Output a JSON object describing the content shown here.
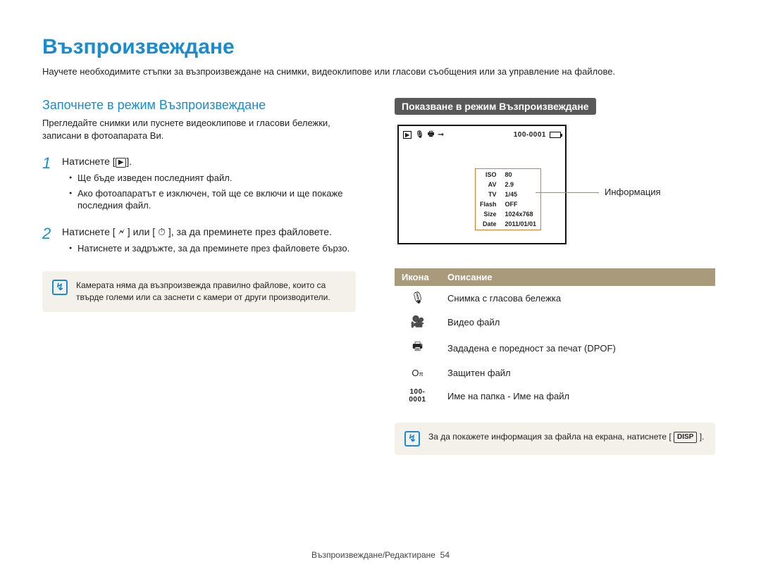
{
  "page_title": "Възпроизвеждане",
  "intro": "Научете необходимите стъпки за възпроизвеждане на снимки, видеоклипове или гласови съобщения или за управление на файлове.",
  "left": {
    "heading": "Започнете в режим Възпроизвеждане",
    "subintro": "Прегледайте снимки или пуснете видеоклипове и гласови бележки, записани в фотоапарата Ви.",
    "steps": [
      {
        "num": "1",
        "label_pre": "Натиснете [",
        "label_post": "].",
        "bullets": [
          "Ще бъде изведен последният файл.",
          "Ако фотоапаратът е изключен, той ще се включи и ще покаже последния файл."
        ]
      },
      {
        "num": "2",
        "label": "Натиснете [ 🗲 ] или [ ⏱ ], за да преминете през файловете.",
        "bullets": [
          "Натиснете и задръжте, за да преминете през файловете бързо."
        ]
      }
    ],
    "note": "Камерата няма да възпроизвежда правилно файлове, които са твърде големи или са заснети с камери от други производители."
  },
  "right": {
    "heading": "Показване в режим Възпроизвеждане",
    "screen": {
      "file_id": "100-0001",
      "info_rows": [
        [
          "ISO",
          "80"
        ],
        [
          "AV",
          "2.9"
        ],
        [
          "TV",
          "1/45"
        ],
        [
          "Flash",
          "OFF"
        ],
        [
          "Size",
          "1024x768"
        ],
        [
          "Date",
          "2011/01/01"
        ]
      ],
      "callout": "Информация"
    },
    "table": {
      "head": [
        "Икона",
        "Описание"
      ],
      "rows": [
        {
          "icon": "mic-icon",
          "glyph": "🎙",
          "desc": "Снимка с гласова бележка"
        },
        {
          "icon": "video-icon",
          "glyph": "🎥",
          "desc": "Видео файл"
        },
        {
          "icon": "printer-icon",
          "glyph": "🖶",
          "desc": "Зададена е поредност за печат (DPOF)"
        },
        {
          "icon": "lock-icon",
          "glyph": "🗝",
          "desc": "Защитен файл"
        },
        {
          "icon": "fileid-icon",
          "glyph": "100-0001",
          "desc": "Име на папка - Име на файл"
        }
      ]
    },
    "note_pre": "За да покажете информация за файла на екрана, натиснете [",
    "note_btn": "DISP",
    "note_post": "]."
  },
  "footer": {
    "text": "Възпроизвеждане/Редактиране",
    "page": "54"
  }
}
